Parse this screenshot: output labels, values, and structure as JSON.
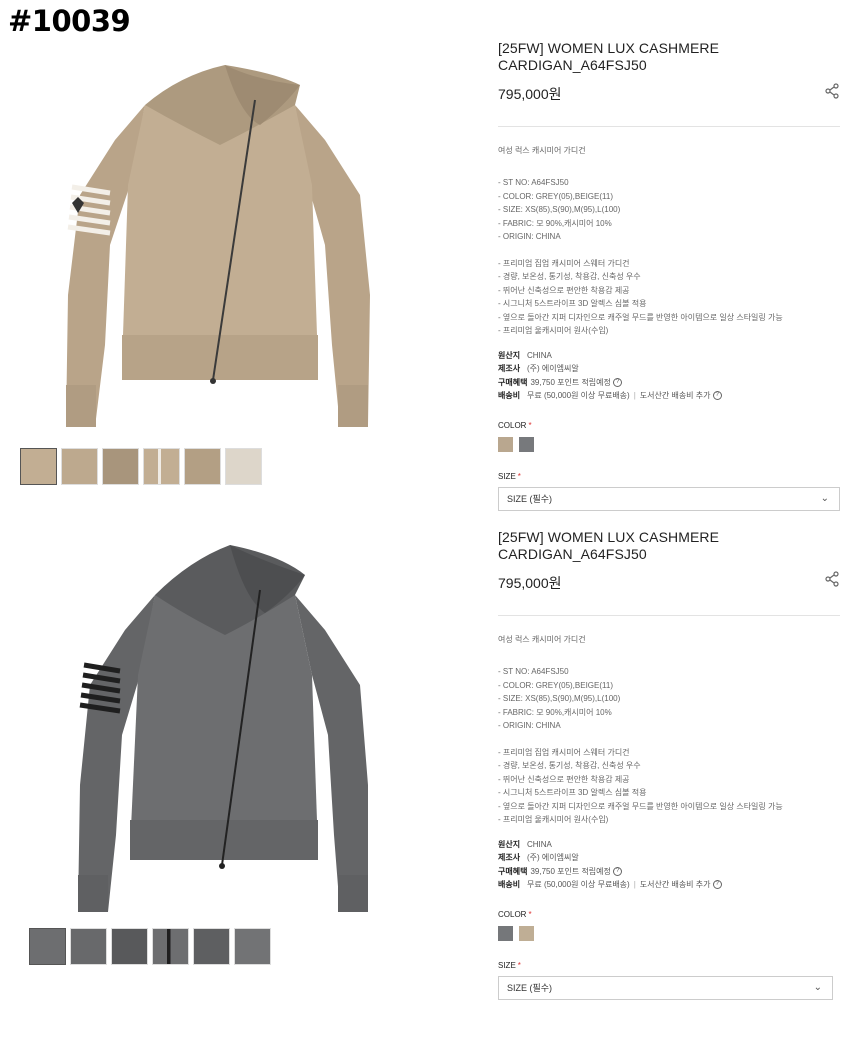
{
  "page_id": "#10039",
  "products": [
    {
      "title": "[25FW] WOMEN LUX CASHMERE CARDIGAN_A64FSJ50",
      "price": "795,000원",
      "subtitle": "여성 럭스 캐시미어 가디건",
      "specs": [
        "- ST NO: A64FSJ50",
        "- COLOR: GREY(05),BEIGE(11)",
        "- SIZE: XS(85),S(90),M(95),L(100)",
        "- FABRIC: 모 90%,캐시미어 10%",
        "- ORIGIN: CHINA"
      ],
      "features": [
        "- 프리미엄 집업 캐시미어 스웨터 가디건",
        "- 경량, 보온성, 통기성, 착용감, 신축성 우수",
        "- 뛰어난 신축성으로 편안한 착용감 제공",
        "- 시그니처 5스트라이프 3D 알렉스 심볼 적용",
        "- 옆으로 돌아간 지퍼 디자인으로 캐주얼 무드를 반영한 아이템으로 일상 스타일링 가능",
        "- 프리미엄 울캐시미어 원사(수입)"
      ],
      "meta": {
        "origin_key": "원산지",
        "origin_val": "CHINA",
        "maker_key": "제조사",
        "maker_val": "(주) 에이엠씨알",
        "benefit_key": "구매혜택",
        "benefit_val": "39,750 포인트 적립예정",
        "ship_key": "배송비",
        "ship_val": "무료 (50,000원 이상 무료배송)",
        "ship_extra": "도서산간 배송비 추가"
      },
      "color_label": "COLOR",
      "swatches": [
        "#b9a78f",
        "#77797c"
      ],
      "size_label": "SIZE",
      "size_select": "SIZE (필수)",
      "required_mark": "*",
      "sweater_color": "#c2ae93",
      "stripe_color": "#f3efe8"
    },
    {
      "title": "[25FW] WOMEN LUX CASHMERE CARDIGAN_A64FSJ50",
      "price": "795,000원",
      "subtitle": "여성 럭스 캐시미어 가디건",
      "specs": [
        "- ST NO: A64FSJ50",
        "- COLOR: GREY(05),BEIGE(11)",
        "- SIZE: XS(85),S(90),M(95),L(100)",
        "- FABRIC: 모 90%,캐시미어 10%",
        "- ORIGIN: CHINA"
      ],
      "features": [
        "- 프리미엄 집업 캐시미어 스웨터 가디건",
        "- 경량, 보온성, 통기성, 착용감, 신축성 우수",
        "- 뛰어난 신축성으로 편안한 착용감 제공",
        "- 시그니처 5스트라이프 3D 알렉스 심볼 적용",
        "- 옆으로 돌아간 지퍼 디자인으로 캐주얼 무드를 반영한 아이템으로 일상 스타일링 가능",
        "- 프리미엄 울캐시미어 원사(수입)"
      ],
      "meta": {
        "origin_key": "원산지",
        "origin_val": "CHINA",
        "maker_key": "제조사",
        "maker_val": "(주) 에이엠씨알",
        "benefit_key": "구매혜택",
        "benefit_val": "39,750 포인트 적립예정",
        "ship_key": "배송비",
        "ship_val": "무료 (50,000원 이상 무료배송)",
        "ship_extra": "도서산간 배송비 추가"
      },
      "color_label": "COLOR",
      "swatches": [
        "#75777a",
        "#bfae95"
      ],
      "size_label": "SIZE",
      "size_select": "SIZE (필수)",
      "required_mark": "*",
      "sweater_color": "#6d6e70",
      "stripe_color": "#1f1f1f"
    }
  ]
}
